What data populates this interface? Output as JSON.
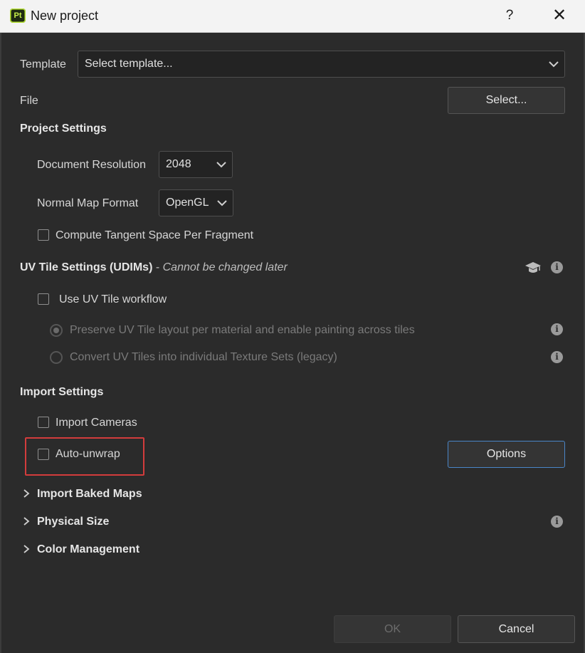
{
  "window": {
    "icon_text": "Pt",
    "title": "New project",
    "help_glyph": "?",
    "close_glyph": "✕"
  },
  "template": {
    "label": "Template",
    "value": "Select template..."
  },
  "file": {
    "label": "File",
    "button": "Select..."
  },
  "project_settings": {
    "header": "Project Settings",
    "document_resolution_label": "Document Resolution",
    "document_resolution_value": "2048",
    "normal_map_format_label": "Normal Map Format",
    "normal_map_format_value": "OpenGL",
    "compute_tangent_label": "Compute Tangent Space Per Fragment",
    "compute_tangent_checked": false
  },
  "uv_tile": {
    "header": "UV Tile Settings (UDIMs)",
    "separator": "-",
    "note": "Cannot be changed later",
    "use_workflow_label": "Use UV Tile workflow",
    "use_workflow_checked": false,
    "option_preserve": "Preserve UV Tile layout per material and enable painting across tiles",
    "option_convert": "Convert UV Tiles into individual Texture Sets (legacy)",
    "selected_option": "preserve"
  },
  "import_settings": {
    "header": "Import Settings",
    "import_cameras_label": "Import Cameras",
    "import_cameras_checked": false,
    "auto_unwrap_label": "Auto-unwrap",
    "auto_unwrap_checked": false,
    "options_button": "Options"
  },
  "sections": {
    "import_baked_maps": "Import Baked Maps",
    "physical_size": "Physical Size",
    "color_management": "Color Management"
  },
  "footer": {
    "ok": "OK",
    "cancel": "Cancel"
  },
  "colors": {
    "background": "#2b2b2b",
    "highlight_border": "#d33c3c",
    "options_border": "#4a86c8"
  }
}
